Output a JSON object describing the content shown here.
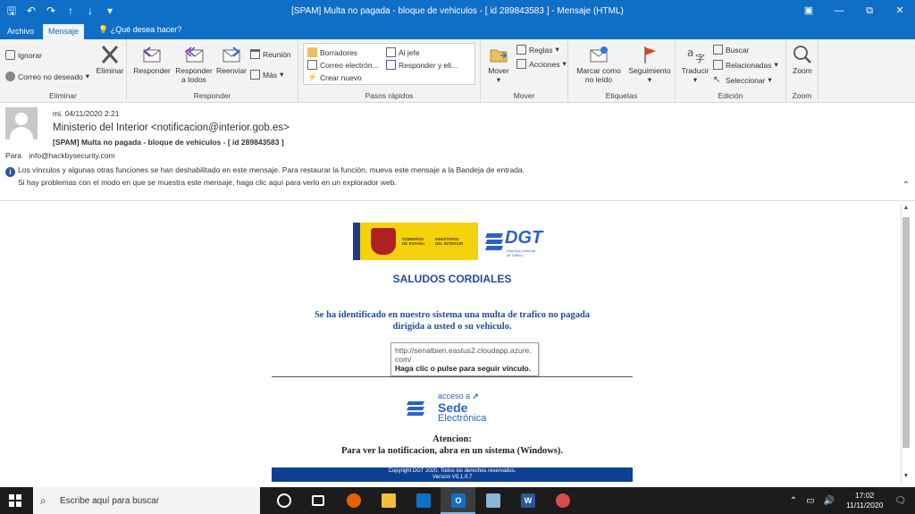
{
  "titlebar": {
    "title": "[SPAM] Multa no pagada - bloque de vehiculos - [ id 289843583  ] - Mensaje (HTML)",
    "qat_icons": [
      "save-icon",
      "undo-icon",
      "redo-icon",
      "up-icon",
      "down-icon",
      "customize-icon"
    ],
    "controls": [
      "ribbon-display-icon",
      "minimize-icon",
      "restore-icon",
      "close-icon"
    ]
  },
  "tabs": {
    "file": "Archivo",
    "message": "Mensaje",
    "tellme": "¿Qué desea hacer?"
  },
  "ribbon": {
    "eliminar": {
      "ignore": "Ignorar",
      "junk": "Correo no deseado",
      "delete": "Eliminar",
      "label": "Eliminar"
    },
    "responder": {
      "reply": "Responder",
      "reply_all_1": "Responder",
      "reply_all_2": "a todos",
      "forward": "Reenviar",
      "meeting": "Reunión",
      "more": "Más",
      "label": "Responder"
    },
    "pasos": {
      "items": [
        "Borradores",
        "Al jefe",
        "Correo electrón...",
        "Responder y eli...",
        "Crear nuevo"
      ],
      "label": "Pasos rápidos"
    },
    "mover": {
      "move": "Mover",
      "rules": "Reglas",
      "actions": "Acciones",
      "label": "Mover"
    },
    "etiquetas": {
      "mark_unread_1": "Marcar como",
      "mark_unread_2": "no leído",
      "followup": "Seguimiento",
      "label": "Etiquetas"
    },
    "edicion": {
      "translate": "Traducir",
      "find": "Buscar",
      "related": "Relacionadas",
      "select": "Seleccionar",
      "label": "Edición"
    },
    "zoom": {
      "zoom": "Zoom",
      "label": "Zoom"
    }
  },
  "message": {
    "date": "mi. 04/11/2020 2:21",
    "sender": "Ministerio del Interior <notificacion@interior.gob.es>",
    "subject": "[SPAM] Multa no pagada - bloque de vehiculos - [ id 289843583  ]",
    "to_label": "Para",
    "to": "info@hackbysecurity.com",
    "info_line1": "Los vínculos y algunas otras funciones se han deshabilitado en este mensaje. Para restaurar la función, mueva este mensaje a la Bandeja de entrada.",
    "info_line2": "Si hay problemas con el modo en que se muestra este mensaje, haga clic aquí para verlo en un explorador web."
  },
  "email": {
    "gob_left": "GOBIERNO\nDE ESPAÑA",
    "gob_right": "MINISTERIO\nDEL INTERIOR",
    "dgt": "DGT",
    "dgt_sub": "Dirección General\nde Tráfico",
    "greeting": "SALUDOS CORDIALES",
    "line1": "Se ha identificado en nuestro sistema una multa de trafico no pagada",
    "line2": "dirigida a usted o su vehiculo.",
    "tooltip_url1": "http://senalbien.eastus2.cloudapp.azure.",
    "tooltip_url2": "com/",
    "tooltip_hint": "Haga clic o pulse para seguir vínculo.",
    "sede_acceso": "acceso a",
    "sede_1": "Sede",
    "sede_2": "Electrónica",
    "atencion": "Atencion:",
    "atencion_text": "Para ver la notificacion, abra en un sistema (Windows).",
    "copyright": "Copyright DGT 2020. Todos los derechos reservados.",
    "version": "Version V5.1.0.7"
  },
  "taskbar": {
    "search_placeholder": "Escribe aquí para buscar",
    "time": "17:02",
    "date": "11/11/2020",
    "apps": [
      "cortana-icon",
      "task-view-icon",
      "firefox-icon",
      "file-explorer-icon",
      "mail-icon",
      "outlook-icon",
      "app-icon",
      "word-icon",
      "paint-icon"
    ]
  },
  "colors": {
    "accent": "#0f6fc6",
    "email_blue": "#1d4d99",
    "footer_blue": "#0d3f94"
  }
}
